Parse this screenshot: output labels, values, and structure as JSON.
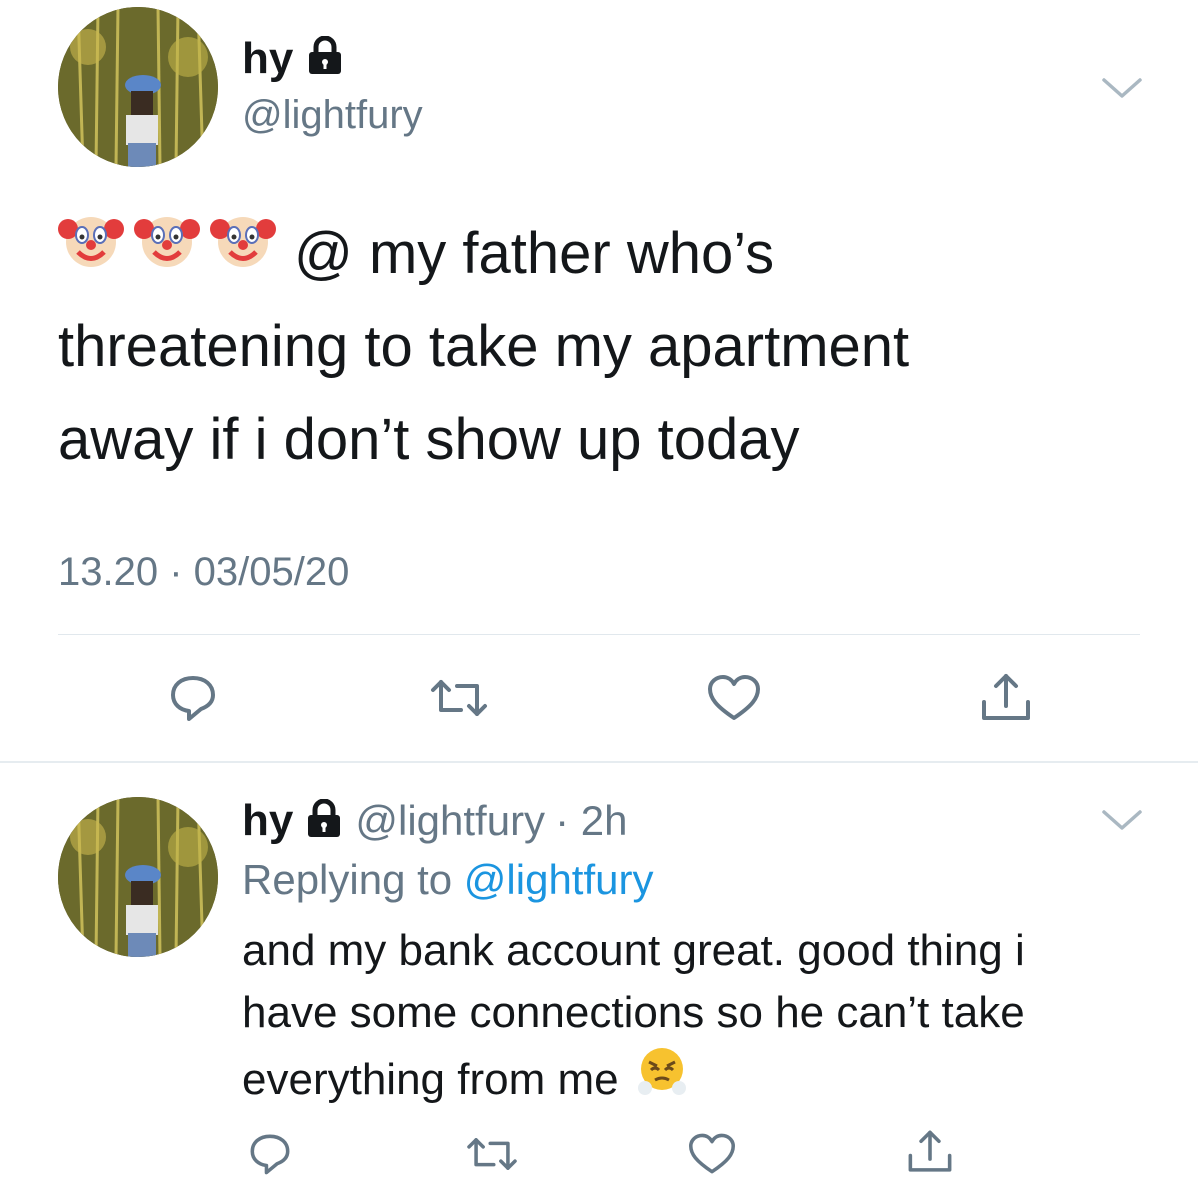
{
  "main_tweet": {
    "display_name": "hy",
    "handle": "@lightfury",
    "emoji_prefix": [
      "clown-face",
      "clown-face",
      "clown-face"
    ],
    "text_line1": "@ my father who’s",
    "text_line2": "threatening to take my apartment",
    "text_line3": "away if i don’t show up today",
    "timestamp": "13.20 · 03/05/20",
    "actions": [
      "reply-icon",
      "retweet-icon",
      "like-icon",
      "share-icon"
    ]
  },
  "reply_tweet": {
    "display_name": "hy",
    "handle": "@lightfury",
    "time_ago": "· 2h",
    "replying_prefix": "Replying to",
    "replying_to": "@lightfury",
    "text_line1": "and my bank account great. good thing i",
    "text_line2": "have some connections so he can’t take",
    "text_line3": "everything from me",
    "emoji_suffix": "face-with-steam-from-nose",
    "actions": [
      "reply-icon",
      "retweet-icon",
      "like-icon",
      "share-icon"
    ]
  },
  "colors": {
    "text": "#14171a",
    "secondary": "#657786",
    "link": "#1b95e0",
    "divider": "#e1e8ed"
  }
}
